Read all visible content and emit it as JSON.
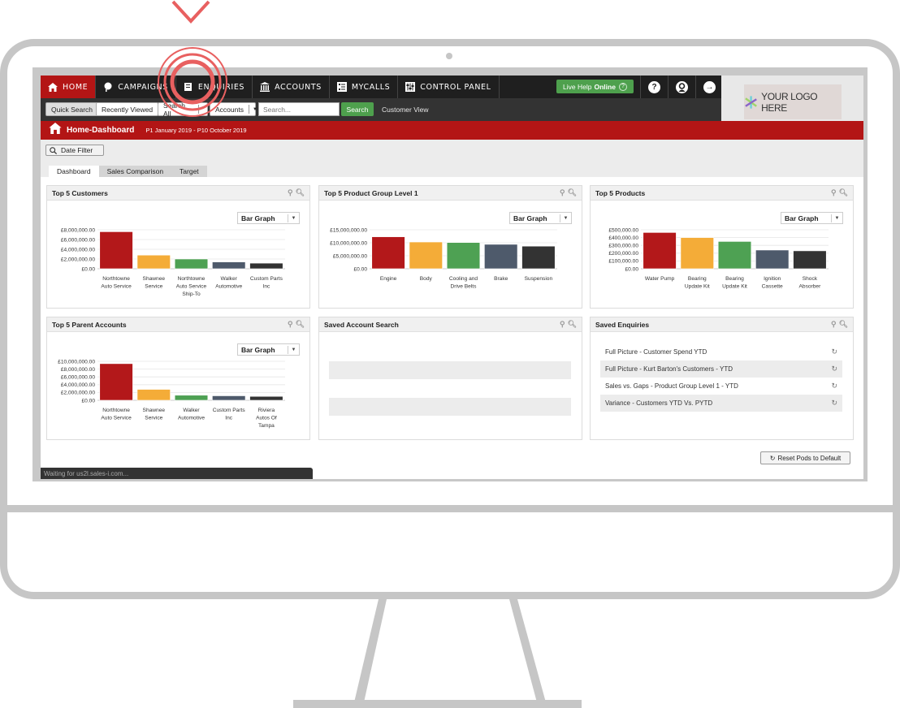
{
  "colors": {
    "brand_red": "#b31515",
    "nav_dark": "#1f1f1f",
    "subnav_dark": "#333333",
    "success_green": "#4ea04d",
    "bar_red": "#b3181a",
    "bar_orange": "#f4ac38",
    "bar_green": "#4ea153",
    "bar_slate": "#4e5a6b",
    "bar_charcoal": "#333333",
    "highlight_ring": "#e86060",
    "frame_grey": "#c6c6c6"
  },
  "nav": {
    "items": [
      {
        "label": "HOME",
        "icon": "home-icon",
        "active": true
      },
      {
        "label": "CAMPAIGNS",
        "icon": "campaign-icon"
      },
      {
        "label": "ENQUIRIES",
        "icon": "enquiries-icon"
      },
      {
        "label": "ACCOUNTS",
        "icon": "bank-icon"
      },
      {
        "label": "MYCALLS",
        "icon": "checklist-icon"
      },
      {
        "label": "CONTROL PANEL",
        "icon": "control-panel-icon"
      }
    ],
    "live_help": {
      "prefix": "Live Help",
      "status": "Online",
      "icon": "?"
    },
    "right_icons": [
      "help-icon",
      "user-icon",
      "logout-icon"
    ],
    "help_glyph": "?",
    "logout_glyph": "→"
  },
  "logo": {
    "text": "YOUR LOGO HERE"
  },
  "subnav": {
    "quick_search": "Quick Search",
    "recently_viewed": "Recently Viewed",
    "search_scope": "Search All",
    "entity_select": "Accounts",
    "search_placeholder": "Search...",
    "search_button": "Search",
    "customer_view": "Customer View"
  },
  "page": {
    "title": "Home-Dashboard",
    "period": "P1 January 2019 - P10 October 2019",
    "date_filter": "Date Filter",
    "tabs": [
      {
        "label": "Dashboard",
        "active": true
      },
      {
        "label": "Sales Comparison"
      },
      {
        "label": "Target"
      }
    ],
    "graph_type": "Bar Graph",
    "reset_button": "Reset Pods to Default",
    "status_text": "Waiting for us2l.sales-i.com..."
  },
  "pods": {
    "top_customers": {
      "title": "Top 5 Customers"
    },
    "top_product_group": {
      "title": "Top 5 Product Group Level 1"
    },
    "top_products": {
      "title": "Top 5 Products"
    },
    "top_parent_accounts": {
      "title": "Top 5 Parent Accounts"
    },
    "saved_account_search": {
      "title": "Saved Account Search"
    },
    "saved_enquiries": {
      "title": "Saved Enquiries",
      "items": [
        "Full Picture - Customer Spend YTD",
        "Full Picture - Kurt Barton's Customers - YTD",
        "Sales vs. Gaps - Product Group Level 1 - YTD",
        "Variance - Customers YTD Vs. PYTD"
      ]
    }
  },
  "chart_data": [
    {
      "id": "top_customers",
      "type": "bar",
      "title": "Top 5 Customers",
      "categories": [
        [
          "Northtowne",
          "Auto Service"
        ],
        [
          "Shawnee",
          "Service"
        ],
        [
          "Northtowne",
          "Auto Service",
          "Ship-To"
        ],
        [
          "Walker",
          "Automotive"
        ],
        [
          "Custom Parts",
          "Inc"
        ]
      ],
      "values": [
        7600000,
        2800000,
        2000000,
        1400000,
        1150000
      ],
      "yticks": [
        0,
        2000000,
        4000000,
        6000000,
        8000000
      ],
      "ytick_labels": [
        "£0.00",
        "£2,000,000.00",
        "£4,000,000.00",
        "£6,000,000.00",
        "£8,000,000.00"
      ],
      "ylim": [
        0,
        8000000
      ],
      "grid": true
    },
    {
      "id": "top_product_group",
      "type": "bar",
      "title": "Top 5 Product Group Level 1",
      "categories": [
        [
          "Engine"
        ],
        [
          "Body"
        ],
        [
          "Cooling and",
          "Drive Belts"
        ],
        [
          "Brake"
        ],
        [
          "Suspension"
        ]
      ],
      "values": [
        12300000,
        10300000,
        10100000,
        9400000,
        8700000
      ],
      "yticks": [
        0,
        5000000,
        10000000,
        15000000
      ],
      "ytick_labels": [
        "£0.00",
        "£5,000,000.00",
        "£10,000,000.00",
        "£15,000,000.00"
      ],
      "ylim": [
        0,
        15000000
      ],
      "grid": true
    },
    {
      "id": "top_products",
      "type": "bar",
      "title": "Top 5 Products",
      "categories": [
        [
          "Water Pump"
        ],
        [
          "Bearing",
          "Update Kit"
        ],
        [
          "Bearing",
          "Update Kit"
        ],
        [
          "Ignition",
          "Cassette"
        ],
        [
          "Shock",
          "Absorber"
        ]
      ],
      "values": [
        465000,
        400000,
        350000,
        240000,
        230000
      ],
      "yticks": [
        0,
        100000,
        200000,
        300000,
        400000,
        500000
      ],
      "ytick_labels": [
        "£0.00",
        "£100,000.00",
        "£200,000.00",
        "£300,000.00",
        "£400,000.00",
        "£500,000.00"
      ],
      "ylim": [
        0,
        500000
      ],
      "grid": true
    },
    {
      "id": "top_parent_accounts",
      "type": "bar",
      "title": "Top 5 Parent Accounts",
      "categories": [
        [
          "Northtowne",
          "Auto Service"
        ],
        [
          "Shawnee",
          "Service"
        ],
        [
          "Walker",
          "Automotive"
        ],
        [
          "Custom Parts",
          "Inc"
        ],
        [
          "Riviera",
          "Autos Of",
          "Tampa"
        ]
      ],
      "values": [
        9400000,
        2800000,
        1300000,
        1150000,
        1000000
      ],
      "yticks": [
        0,
        2000000,
        4000000,
        6000000,
        8000000,
        10000000
      ],
      "ytick_labels": [
        "£0.00",
        "£2,000,000.00",
        "£4,000,000.00",
        "£6,000,000.00",
        "£8,000,000.00",
        "£10,000,000.00"
      ],
      "ylim": [
        0,
        10000000
      ],
      "grid": true
    }
  ]
}
